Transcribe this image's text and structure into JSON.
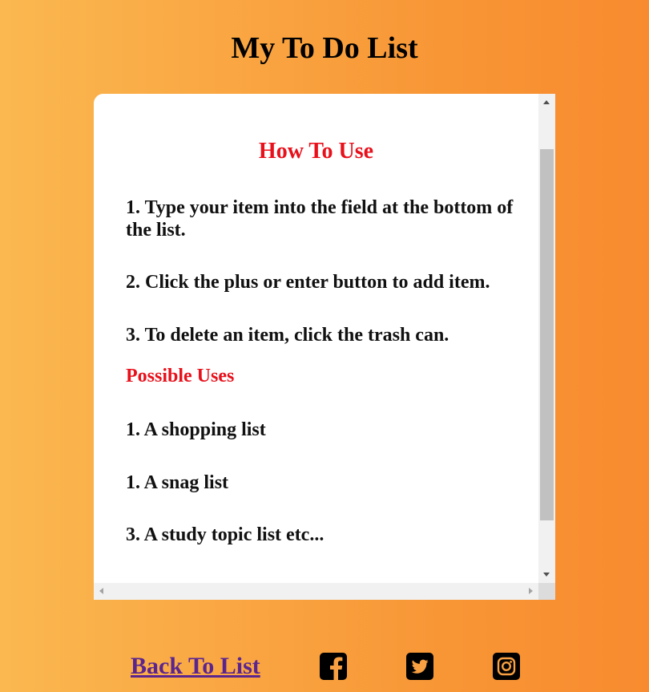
{
  "header": {
    "title": "My To Do List"
  },
  "instructions": {
    "title": "How To Use",
    "steps": [
      "1. Type your item into the field at the bottom of the list.",
      "2. Click the plus or enter button to add item.",
      "3. To delete an item, click the trash can."
    ],
    "uses_title": "Possible Uses",
    "uses": [
      "1. A shopping list",
      "1. A snag list",
      "3. A study topic list etc..."
    ]
  },
  "footer": {
    "back_link": "Back To List",
    "social_icons": [
      "facebook-icon",
      "twitter-icon",
      "instagram-icon"
    ]
  },
  "colors": {
    "heading_red": "#e8101b",
    "link_purple": "#5b2590",
    "gradient_start": "#fbb850",
    "gradient_end": "#f88b2f"
  }
}
